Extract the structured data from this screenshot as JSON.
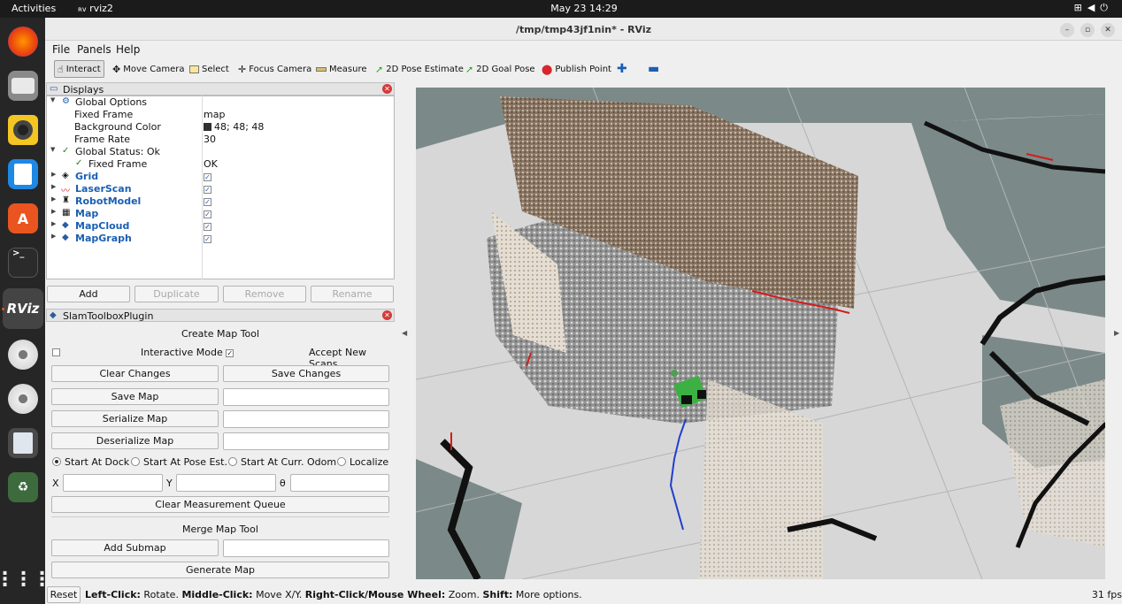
{
  "topbar": {
    "activities": "Activities",
    "app_name": "rviz2",
    "clock": "May 23  14:29"
  },
  "dock": {
    "items": [
      "firefox-icon",
      "files-icon",
      "rhythmbox-icon",
      "writer-icon",
      "app-center-icon",
      "terminal-icon",
      "rviz-icon",
      "disc-icon",
      "disc-icon",
      "text-editor-icon",
      "trash-icon"
    ],
    "apps_grid_icon": "show-apps-icon",
    "rviz_label": "RViz"
  },
  "window": {
    "title": "/tmp/tmp43jf1nin* - RViz"
  },
  "menu": {
    "file": "File",
    "panels": "Panels",
    "help": "Help"
  },
  "toolbar": {
    "interact": "Interact",
    "move_camera": "Move Camera",
    "select": "Select",
    "focus_camera": "Focus Camera",
    "measure": "Measure",
    "pose_estimate": "2D Pose Estimate",
    "goal_pose": "2D Goal Pose",
    "publish_point": "Publish Point"
  },
  "displays": {
    "panel_title": "Displays",
    "global_options": "Global Options",
    "fixed_frame_label": "Fixed Frame",
    "fixed_frame_value": "map",
    "background_color_label": "Background Color",
    "background_color_value": "48; 48; 48",
    "frame_rate_label": "Frame Rate",
    "frame_rate_value": "30",
    "global_status": "Global Status: Ok",
    "status_fixed_frame_label": "Fixed Frame",
    "status_fixed_frame_value": "OK",
    "items": [
      "Grid",
      "LaserScan",
      "RobotModel",
      "Map",
      "MapCloud",
      "MapGraph"
    ],
    "add": "Add",
    "duplicate": "Duplicate",
    "remove": "Remove",
    "rename": "Rename"
  },
  "slam": {
    "panel_title": "SlamToolboxPlugin",
    "create_map_tool": "Create Map Tool",
    "interactive_mode": "Interactive Mode",
    "accept_new_scans": "Accept New Scans",
    "clear_changes": "Clear Changes",
    "save_changes": "Save Changes",
    "save_map": "Save Map",
    "serialize_map": "Serialize Map",
    "deserialize_map": "Deserialize Map",
    "start_at_dock": "Start At Dock",
    "start_at_pose": "Start At Pose Est.",
    "start_at_odom": "Start At Curr. Odom",
    "localize": "Localize",
    "x_label": "X",
    "y_label": "Y",
    "theta_label": "θ",
    "clear_measurement_queue": "Clear Measurement Queue",
    "merge_map_tool": "Merge Map Tool",
    "add_submap": "Add Submap",
    "generate_map": "Generate Map"
  },
  "status": {
    "reset": "Reset",
    "left_click": "Left-Click:",
    "left_click_desc": " Rotate. ",
    "middle_click": "Middle-Click:",
    "middle_click_desc": " Move X/Y. ",
    "right_click": "Right-Click/Mouse Wheel:",
    "right_click_desc": " Zoom. ",
    "shift": "Shift:",
    "shift_desc": " More options.",
    "fps": "31 fps"
  },
  "colors": {
    "accent": "#e95420",
    "link_blue": "#1a5fb4",
    "viewport_bg": "#7b8a89",
    "map_free": "#d7d7d7",
    "robot": "#3cb043",
    "path": "#1f3fd1"
  }
}
